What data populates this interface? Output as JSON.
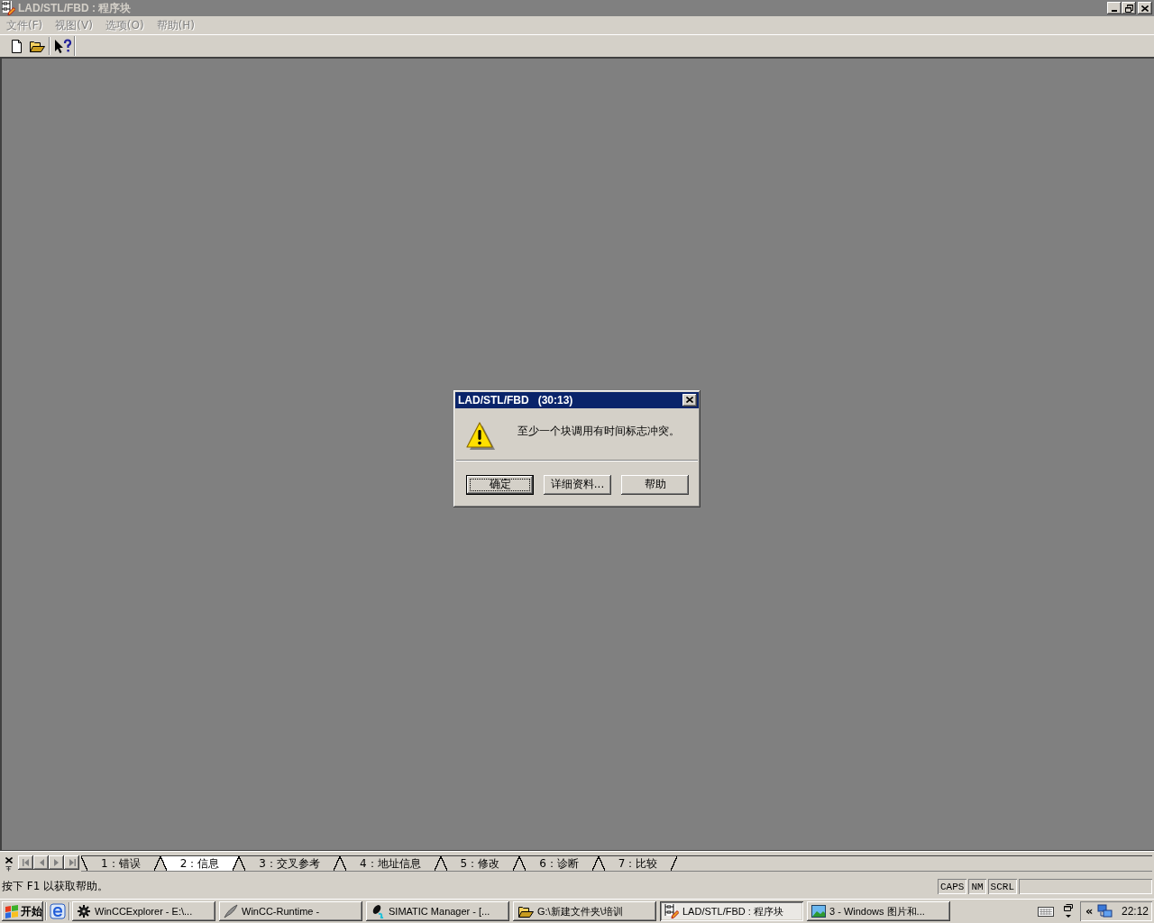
{
  "window": {
    "title": "LAD/STL/FBD : 程序块",
    "active": false
  },
  "menu": [
    {
      "label": "文件(F)",
      "disabled": true
    },
    {
      "label": "视图(V)",
      "disabled": true
    },
    {
      "label": "选项(O)",
      "disabled": true
    },
    {
      "label": "帮助(H)",
      "disabled": true
    }
  ],
  "dialog": {
    "title": "LAD/STL/FBD   (30:13)",
    "message": "至少一个块调用有时间标志冲突。",
    "buttons": [
      {
        "label": "确定",
        "focused": true
      },
      {
        "label": "详细资料...",
        "focused": false
      },
      {
        "label": "帮助",
        "focused": false
      }
    ]
  },
  "output_tabs": [
    {
      "label": "1：错误",
      "selected": false
    },
    {
      "label": "2：信息",
      "selected": true
    },
    {
      "label": "3：交叉参考",
      "selected": false
    },
    {
      "label": "4：地址信息",
      "selected": false
    },
    {
      "label": "5：修改",
      "selected": false
    },
    {
      "label": "6：诊断",
      "selected": false
    },
    {
      "label": "7：比较",
      "selected": false
    }
  ],
  "status_bar": {
    "text": "按下 F1 以获取帮助。",
    "indicators": [
      "CAPS",
      "NM",
      "SCRL"
    ]
  },
  "taskbar": {
    "start": "开始",
    "tasks": [
      {
        "kind": "gear",
        "label": "WinCCExplorer - E:\\...",
        "selected": false
      },
      {
        "kind": "quill",
        "label": "WinCC-Runtime -",
        "selected": false
      },
      {
        "kind": "mouse",
        "label": "SIMATIC Manager - [...",
        "selected": false
      },
      {
        "kind": "folder",
        "label": "G:\\新建文件夹\\培训",
        "selected": false
      },
      {
        "kind": "ladder",
        "label": "LAD/STL/FBD : 程序块",
        "selected": true
      },
      {
        "kind": "landscape",
        "label": "3 - Windows 图片和...",
        "selected": false
      }
    ],
    "tray_toggle": "«",
    "clock": "22:12"
  }
}
